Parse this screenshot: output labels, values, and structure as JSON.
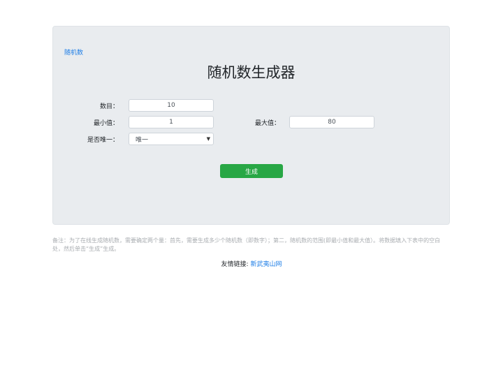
{
  "breadcrumb": {
    "label": "随机数"
  },
  "title": "随机数生成器",
  "form": {
    "count": {
      "label": "数目：",
      "value": "10"
    },
    "min": {
      "label": "最小值：",
      "value": "1"
    },
    "max": {
      "label": "最大值：",
      "value": "80"
    },
    "unique": {
      "label": "是否唯一：",
      "selected": "唯一"
    },
    "generate_label": "生成"
  },
  "note": "备注：为了在线生成随机数，需要确定两个量：首先，需要生成多少个随机数（即数字）；第二，随机数的范围(即最小值和最大值）。将数据填入下表中的空白处，然后单击“生成”生成。",
  "friend_links": {
    "label": "友情链接:",
    "items": [
      {
        "text": "新武夷山网"
      }
    ]
  },
  "colors": {
    "panel_bg": "#e9ecef",
    "button_bg": "#28a745",
    "link": "#1e7ee6"
  }
}
